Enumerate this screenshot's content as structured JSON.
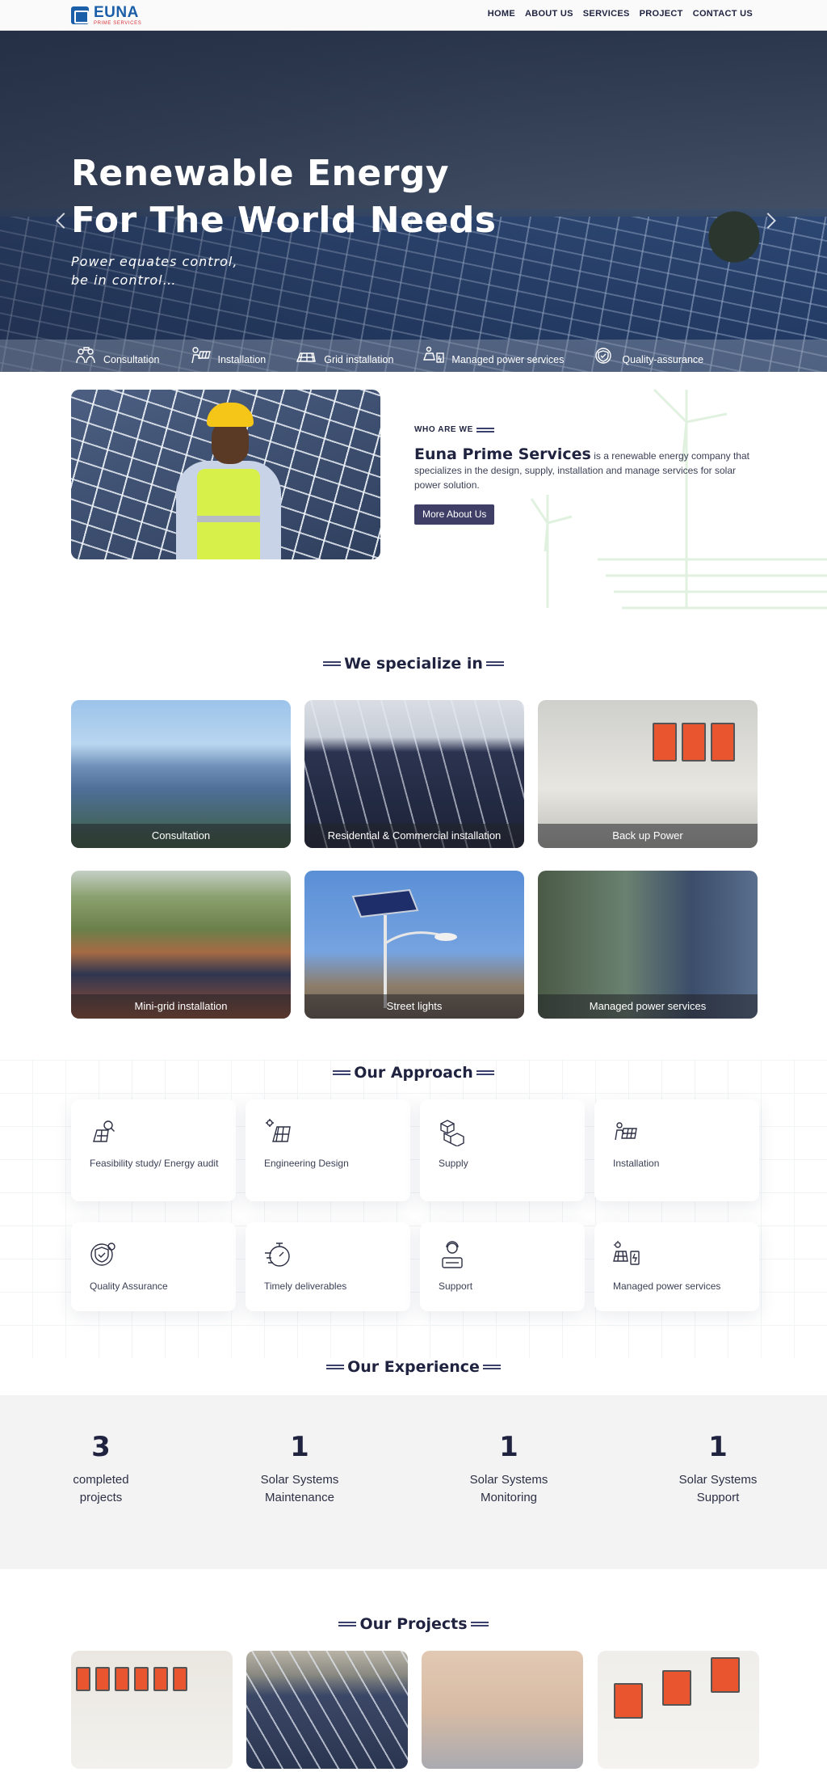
{
  "brand": {
    "name": "EUNA",
    "tagline": "PRIME SERVICES"
  },
  "nav": {
    "items": [
      "HOME",
      "ABOUT US",
      "SERVICES",
      "PROJECT",
      "CONTACT US"
    ]
  },
  "hero": {
    "title_line1": "Renewable Energy",
    "title_line2": "For The World Needs",
    "subtitle_line1": "Power equates control,",
    "subtitle_line2": "be in control…",
    "features": [
      {
        "label": "Consultation",
        "icon": "consultation-icon"
      },
      {
        "label": "Installation",
        "icon": "installation-icon"
      },
      {
        "label": "Grid installation",
        "icon": "grid-installation-icon"
      },
      {
        "label": "Managed power services",
        "icon": "managed-power-icon"
      },
      {
        "label": "Quality-assurance",
        "icon": "quality-assurance-icon"
      }
    ]
  },
  "about": {
    "label": "WHO ARE WE",
    "brand": "Euna Prime Services",
    "text": " is a renewable energy company that specializes in the design, supply, installation and manage services for solar power solution.",
    "button": "More About Us"
  },
  "specialize": {
    "title": "We specialize in",
    "cards": [
      "Consultation",
      "Residential & Commercial installation",
      "Back up Power",
      "Mini-grid installation",
      "Street lights",
      "Managed power services"
    ]
  },
  "approach": {
    "title": "Our Approach",
    "items": [
      {
        "label": "Feasibility study/ Energy audit",
        "icon": "feasibility-icon"
      },
      {
        "label": "Engineering Design",
        "icon": "engineering-design-icon"
      },
      {
        "label": "Supply",
        "icon": "supply-boxes-icon"
      },
      {
        "label": "Installation",
        "icon": "installation-icon"
      },
      {
        "label": "Quality Assurance",
        "icon": "quality-assurance-icon"
      },
      {
        "label": "Timely deliverables",
        "icon": "stopwatch-icon"
      },
      {
        "label": "Support",
        "icon": "support-icon"
      },
      {
        "label": "Managed power services",
        "icon": "managed-power-icon"
      }
    ]
  },
  "experience": {
    "title": "Our Experience",
    "stats": [
      {
        "value": "3",
        "line1": "completed",
        "line2": "projects"
      },
      {
        "value": "1",
        "line1": "Solar Systems",
        "line2": "Maintenance"
      },
      {
        "value": "1",
        "line1": "Solar Systems",
        "line2": "Monitoring"
      },
      {
        "value": "1",
        "line1": "Solar Systems",
        "line2": "Support"
      }
    ]
  },
  "projects": {
    "title": "Our Projects"
  },
  "colors": {
    "primary_dark": "#1f2340",
    "button": "#3e3e66",
    "logo_blue": "#1a5fa8",
    "logo_red": "#d8333a"
  }
}
